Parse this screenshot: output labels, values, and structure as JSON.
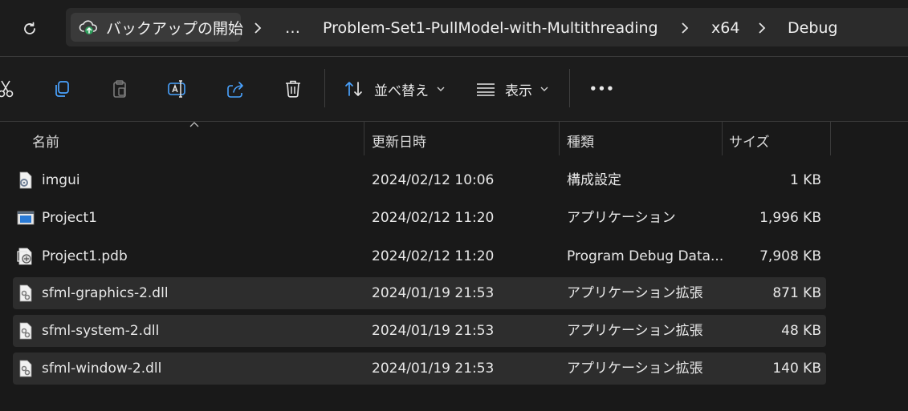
{
  "address_bar": {
    "backup_label": "バックアップの開始",
    "breadcrumbs": [
      "…",
      "Problem-Set1-PullModel-with-Multithreading",
      "x64",
      "Debug"
    ]
  },
  "toolbar": {
    "sort_label": "並べ替え",
    "view_label": "表示",
    "more_label": "•••"
  },
  "columns": {
    "name": "名前",
    "modified": "更新日時",
    "type": "種類",
    "size": "サイズ"
  },
  "files": [
    {
      "name": "imgui",
      "modified": "2024/02/12 10:06",
      "type": "構成設定",
      "size": "1 KB",
      "icon": "config-file-icon",
      "selected": false
    },
    {
      "name": "Project1",
      "modified": "2024/02/12 11:20",
      "type": "アプリケーション",
      "size": "1,996 KB",
      "icon": "application-icon",
      "selected": false
    },
    {
      "name": "Project1.pdb",
      "modified": "2024/02/12 11:20",
      "type": "Program Debug Data...",
      "size": "7,908 KB",
      "icon": "pdb-file-icon",
      "selected": false
    },
    {
      "name": "sfml-graphics-2.dll",
      "modified": "2024/01/19 21:53",
      "type": "アプリケーション拡張",
      "size": "871 KB",
      "icon": "dll-file-icon",
      "selected": true
    },
    {
      "name": "sfml-system-2.dll",
      "modified": "2024/01/19 21:53",
      "type": "アプリケーション拡張",
      "size": "48 KB",
      "icon": "dll-file-icon",
      "selected": true
    },
    {
      "name": "sfml-window-2.dll",
      "modified": "2024/01/19 21:53",
      "type": "アプリケーション拡張",
      "size": "140 KB",
      "icon": "dll-file-icon",
      "selected": true
    }
  ],
  "colors": {
    "background": "#191919",
    "selected_row": "#2d2d2d",
    "crumb_bar": "#2b2b2b",
    "accent_blue": "#4aa3ff"
  }
}
